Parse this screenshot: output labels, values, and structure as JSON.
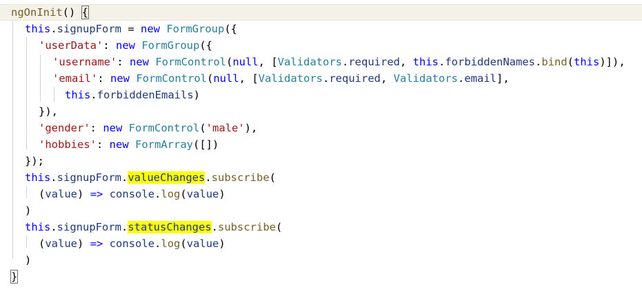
{
  "colors": {
    "keyword": "#0000ff",
    "property": "#1f377f",
    "function": "#795e26",
    "class": "#267f99",
    "string": "#a31515",
    "punctuation": "#000000",
    "highlight": "#ffff0c",
    "current_line": "#f3f1e8"
  },
  "lines": [
    [
      {
        "t": "ngOnInit",
        "c": "fn"
      },
      {
        "t": "() ",
        "c": "punc"
      },
      {
        "t": "{",
        "c": "punc",
        "bracket": true
      }
    ],
    [
      {
        "t": "this",
        "c": "kw"
      },
      {
        "t": ".",
        "c": "punc"
      },
      {
        "t": "signupForm",
        "c": "prop"
      },
      {
        "t": " = ",
        "c": "punc"
      },
      {
        "t": "new",
        "c": "kw"
      },
      {
        "t": " ",
        "c": "punc"
      },
      {
        "t": "FormGroup",
        "c": "ctor"
      },
      {
        "t": "({",
        "c": "punc"
      }
    ],
    [
      {
        "t": "'userData'",
        "c": "str"
      },
      {
        "t": ": ",
        "c": "punc"
      },
      {
        "t": "new",
        "c": "kw"
      },
      {
        "t": " ",
        "c": "punc"
      },
      {
        "t": "FormGroup",
        "c": "ctor"
      },
      {
        "t": "({",
        "c": "punc"
      }
    ],
    [
      {
        "t": "'username'",
        "c": "str"
      },
      {
        "t": ": ",
        "c": "punc"
      },
      {
        "t": "new",
        "c": "kw"
      },
      {
        "t": " ",
        "c": "punc"
      },
      {
        "t": "FormControl",
        "c": "ctor"
      },
      {
        "t": "(",
        "c": "punc"
      },
      {
        "t": "null",
        "c": "kw"
      },
      {
        "t": ", [",
        "c": "punc"
      },
      {
        "t": "Validators",
        "c": "ctor"
      },
      {
        "t": ".",
        "c": "punc"
      },
      {
        "t": "required",
        "c": "prop"
      },
      {
        "t": ", ",
        "c": "punc"
      },
      {
        "t": "this",
        "c": "kw"
      },
      {
        "t": ".",
        "c": "punc"
      },
      {
        "t": "forbiddenNames",
        "c": "prop"
      },
      {
        "t": ".",
        "c": "punc"
      },
      {
        "t": "bind",
        "c": "fn"
      },
      {
        "t": "(",
        "c": "punc"
      },
      {
        "t": "this",
        "c": "kw"
      },
      {
        "t": ")]),",
        "c": "punc"
      }
    ],
    [
      {
        "t": "'email'",
        "c": "str"
      },
      {
        "t": ": ",
        "c": "punc"
      },
      {
        "t": "new",
        "c": "kw"
      },
      {
        "t": " ",
        "c": "punc"
      },
      {
        "t": "FormControl",
        "c": "ctor"
      },
      {
        "t": "(",
        "c": "punc"
      },
      {
        "t": "null",
        "c": "kw"
      },
      {
        "t": ", [",
        "c": "punc"
      },
      {
        "t": "Validators",
        "c": "ctor"
      },
      {
        "t": ".",
        "c": "punc"
      },
      {
        "t": "required",
        "c": "prop"
      },
      {
        "t": ", ",
        "c": "punc"
      },
      {
        "t": "Validators",
        "c": "ctor"
      },
      {
        "t": ".",
        "c": "punc"
      },
      {
        "t": "email",
        "c": "prop"
      },
      {
        "t": "],",
        "c": "punc"
      }
    ],
    [
      {
        "t": "this",
        "c": "kw"
      },
      {
        "t": ".",
        "c": "punc"
      },
      {
        "t": "forbiddenEmails",
        "c": "prop"
      },
      {
        "t": ")",
        "c": "punc"
      }
    ],
    [
      {
        "t": "}),",
        "c": "punc"
      }
    ],
    [
      {
        "t": "'gender'",
        "c": "str"
      },
      {
        "t": ": ",
        "c": "punc"
      },
      {
        "t": "new",
        "c": "kw"
      },
      {
        "t": " ",
        "c": "punc"
      },
      {
        "t": "FormControl",
        "c": "ctor"
      },
      {
        "t": "(",
        "c": "punc"
      },
      {
        "t": "'male'",
        "c": "str"
      },
      {
        "t": "),",
        "c": "punc"
      }
    ],
    [
      {
        "t": "'hobbies'",
        "c": "str"
      },
      {
        "t": ": ",
        "c": "punc"
      },
      {
        "t": "new",
        "c": "kw"
      },
      {
        "t": " ",
        "c": "punc"
      },
      {
        "t": "FormArray",
        "c": "ctor"
      },
      {
        "t": "([])",
        "c": "punc"
      }
    ],
    [
      {
        "t": "});",
        "c": "punc"
      }
    ],
    [
      {
        "t": "this",
        "c": "kw"
      },
      {
        "t": ".",
        "c": "punc"
      },
      {
        "t": "signupForm",
        "c": "prop"
      },
      {
        "t": ".",
        "c": "punc"
      },
      {
        "t": "valueChanges",
        "c": "prop",
        "hl": true
      },
      {
        "t": ".",
        "c": "punc"
      },
      {
        "t": "subscribe",
        "c": "fn"
      },
      {
        "t": "(",
        "c": "punc"
      }
    ],
    [
      {
        "t": "(",
        "c": "punc"
      },
      {
        "t": "value",
        "c": "prop"
      },
      {
        "t": ") ",
        "c": "punc"
      },
      {
        "t": "=>",
        "c": "kw"
      },
      {
        "t": " ",
        "c": "punc"
      },
      {
        "t": "console",
        "c": "prop"
      },
      {
        "t": ".",
        "c": "punc"
      },
      {
        "t": "log",
        "c": "fn"
      },
      {
        "t": "(",
        "c": "punc"
      },
      {
        "t": "value",
        "c": "prop"
      },
      {
        "t": ")",
        "c": "punc"
      }
    ],
    [
      {
        "t": ")",
        "c": "punc"
      }
    ],
    [
      {
        "t": "this",
        "c": "kw"
      },
      {
        "t": ".",
        "c": "punc"
      },
      {
        "t": "signupForm",
        "c": "prop"
      },
      {
        "t": ".",
        "c": "punc"
      },
      {
        "t": "statusChanges",
        "c": "prop",
        "hl": true
      },
      {
        "t": ".",
        "c": "punc"
      },
      {
        "t": "subscribe",
        "c": "fn"
      },
      {
        "t": "(",
        "c": "punc"
      }
    ],
    [
      {
        "t": "(",
        "c": "punc"
      },
      {
        "t": "value",
        "c": "prop"
      },
      {
        "t": ") ",
        "c": "punc"
      },
      {
        "t": "=>",
        "c": "kw"
      },
      {
        "t": " ",
        "c": "punc"
      },
      {
        "t": "console",
        "c": "prop"
      },
      {
        "t": ".",
        "c": "punc"
      },
      {
        "t": "log",
        "c": "fn"
      },
      {
        "t": "(",
        "c": "punc"
      },
      {
        "t": "value",
        "c": "prop"
      },
      {
        "t": ")",
        "c": "punc"
      }
    ],
    [
      {
        "t": ")",
        "c": "punc"
      }
    ],
    [
      {
        "t": "}",
        "c": "punc",
        "bracket": true
      }
    ]
  ]
}
